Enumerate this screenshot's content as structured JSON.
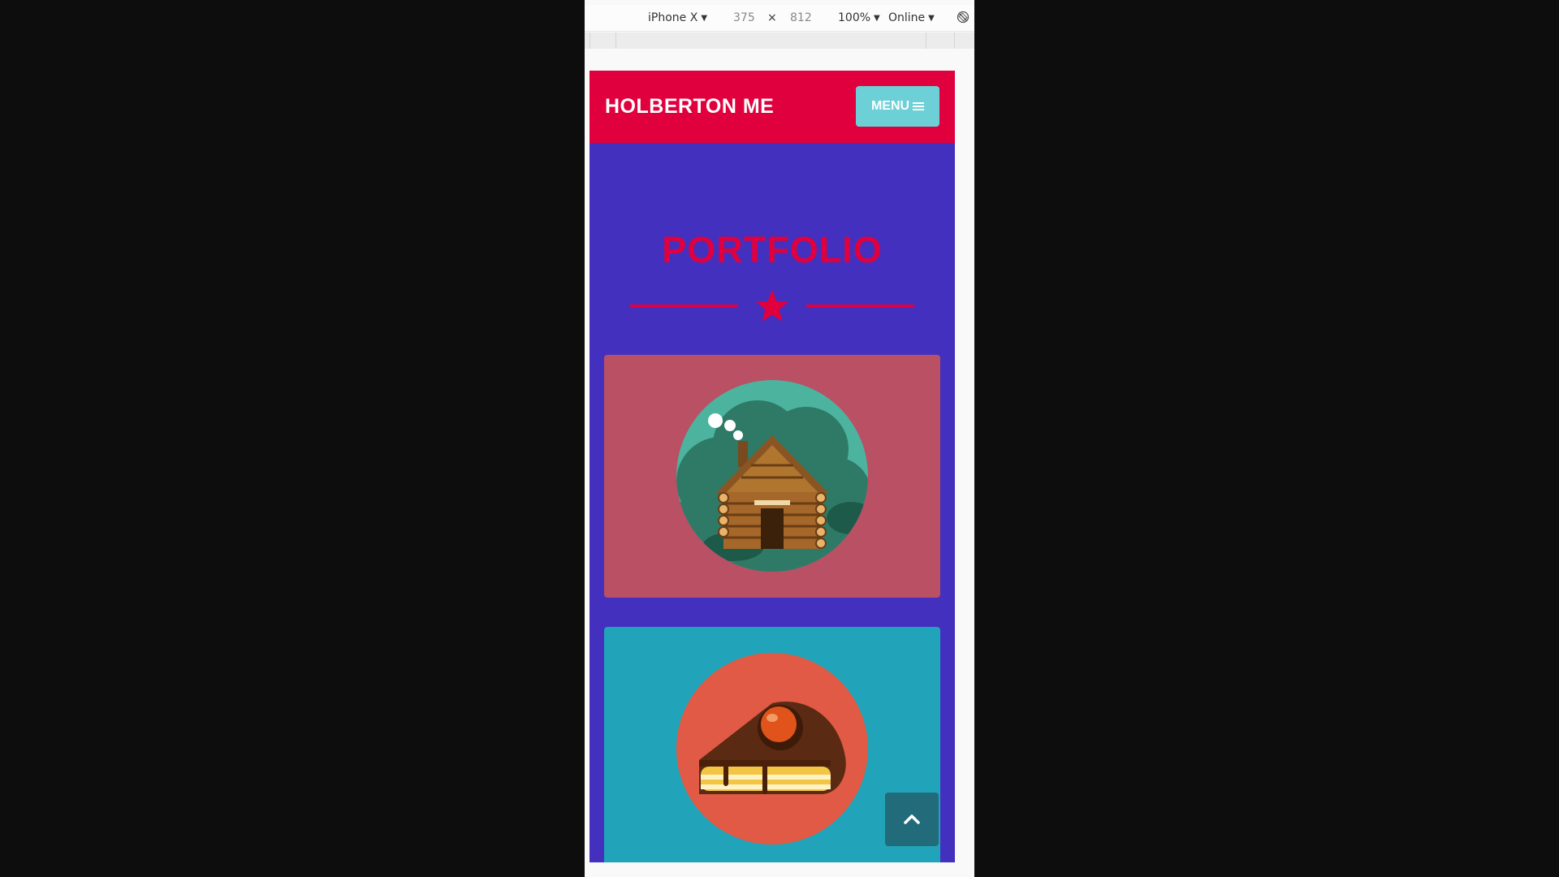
{
  "devtools": {
    "device": "iPhone X",
    "width": "375",
    "times": "×",
    "height": "812",
    "zoom": "100%",
    "network": "Online"
  },
  "site": {
    "brand": "HOLBERTON ME",
    "menu_label": "MENU",
    "section_title": "PORTFOLIO"
  },
  "cards": [
    {
      "image": "log-cabin-illustration",
      "color": "#b95064"
    },
    {
      "image": "cake-slice-illustration",
      "color": "#21a4b9"
    }
  ],
  "colors": {
    "header": "#e1003e",
    "background": "#4330be",
    "menu_button": "#6dd0d6",
    "accent": "#e1003e",
    "back_to_top": "#226b7a"
  }
}
